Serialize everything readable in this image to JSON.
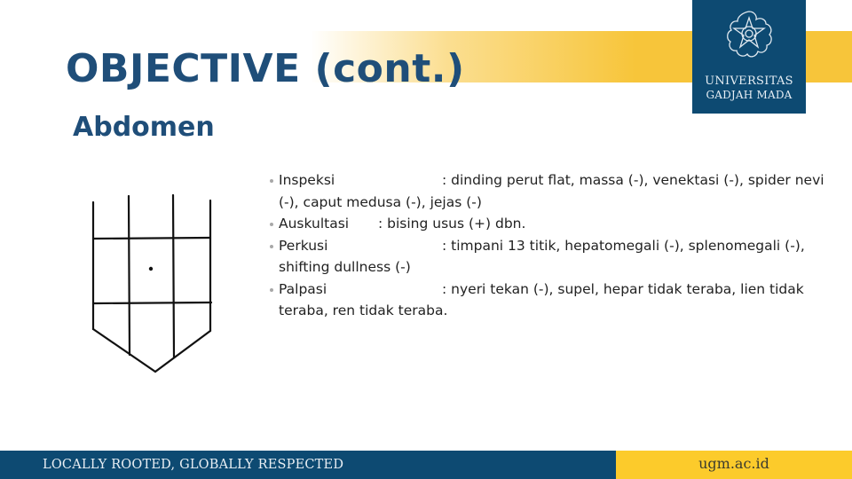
{
  "slide": {
    "title": "OBJECTIVE (cont.)",
    "subtitle": "Abdomen"
  },
  "logo": {
    "icon": "ugm-emblem-icon",
    "line1": "UNIVERSITAS",
    "line2": "GADJAH MADA"
  },
  "findings": [
    {
      "label": "Inspeksi",
      "separator": ": ",
      "text": "dinding perut flat, massa (-), venektasi (-), spider nevi (-), caput medusa (-), jejas (-)"
    },
    {
      "label": "Auskultasi",
      "separator": ": ",
      "text": "bising usus (+) dbn."
    },
    {
      "label": "Perkusi",
      "separator": ": ",
      "text": "timpani 13 titik, hepatomegali (-), splenomegali (-), shifting dullness (-)"
    },
    {
      "label": "Palpasi",
      "separator": ": ",
      "text": "nyeri tekan (-), supel, hepar tidak teraba, lien tidak teraba,  ren tidak teraba."
    }
  ],
  "diagram": {
    "name": "abdomen-nine-region-diagram",
    "marker": "umbilicus-dot"
  },
  "footer": {
    "tagline": "LOCALLY ROOTED, GLOBALLY RESPECTED",
    "url": "ugm.ac.id"
  },
  "colors": {
    "brand_blue": "#0d4a72",
    "title_blue": "#1f4e79",
    "brand_yellow": "#fccb2b"
  }
}
